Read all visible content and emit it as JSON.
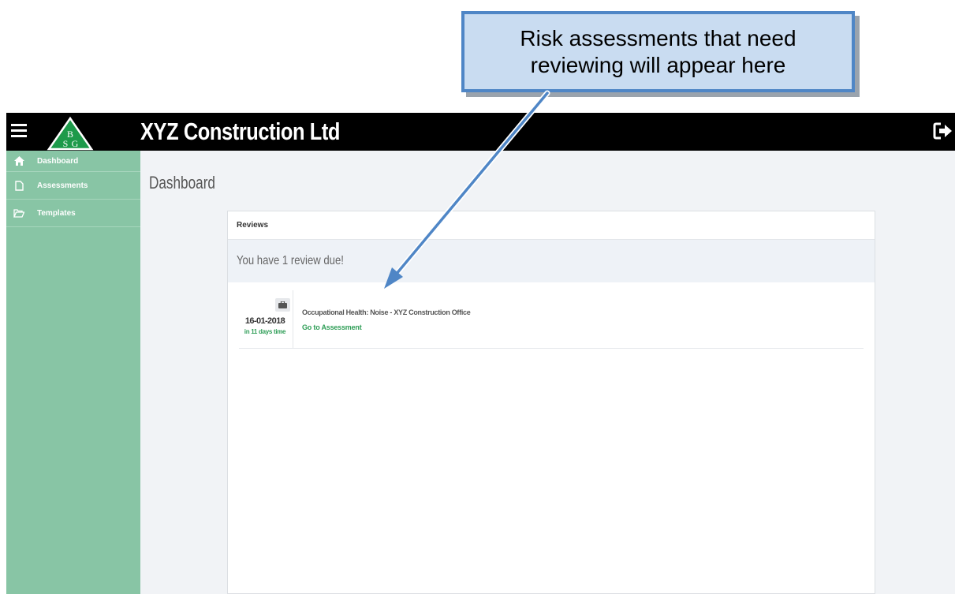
{
  "callout": {
    "line1": "Risk assessments that need",
    "line2": "reviewing will appear here"
  },
  "header": {
    "menu_icon": "hamburger-icon",
    "logo_letters": [
      "B",
      "S",
      "G"
    ],
    "company": "XYZ Construction Ltd",
    "logout_icon": "sign-out-icon"
  },
  "sidebar": {
    "items": [
      {
        "icon": "home-icon",
        "label": "Dashboard"
      },
      {
        "icon": "file-icon",
        "label": "Assessments"
      },
      {
        "icon": "folder-open-icon",
        "label": "Templates"
      }
    ]
  },
  "main": {
    "title": "Dashboard",
    "panel": {
      "heading": "Reviews",
      "summary": "You have 1 review due!",
      "reviews": [
        {
          "icon": "briefcase-icon",
          "date": "16-01-2018",
          "relative": "in 11 days time",
          "title": "Occupational Health: Noise - XYZ Construction Office",
          "link": "Go to Assessment"
        }
      ]
    }
  },
  "colors": {
    "sidebar": "#88c5a5",
    "topbar": "#000000",
    "accent_green": "#2f9e57",
    "callout_fill": "#c9dcf1",
    "callout_border": "#4f86c6"
  }
}
